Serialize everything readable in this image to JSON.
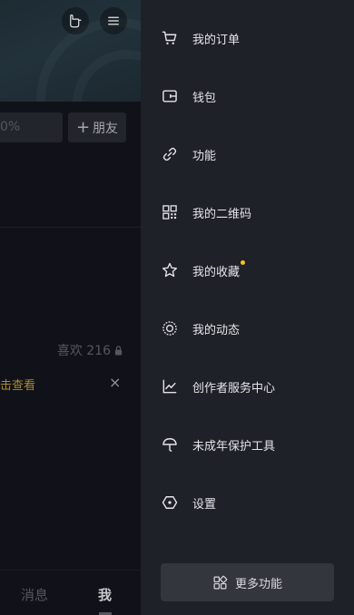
{
  "profile": {
    "edit_fragment": "0%",
    "add_friend_label": "朋友",
    "likes_text": "喜欢 216",
    "notice_fragment": "击查看",
    "notice_close": "×"
  },
  "tabbar": {
    "messages_label": "消息",
    "me_label": "我"
  },
  "drawer": {
    "items": [
      {
        "label": "我的订单",
        "icon": "cart-icon"
      },
      {
        "label": "钱包",
        "icon": "wallet-icon"
      },
      {
        "label": "功能",
        "icon": "link-icon"
      },
      {
        "label": "我的二维码",
        "icon": "qrcode-icon"
      },
      {
        "label": "我的收藏",
        "icon": "star-icon"
      },
      {
        "label": "我的动态",
        "icon": "activity-icon"
      },
      {
        "label": "创作者服务中心",
        "icon": "chart-icon"
      },
      {
        "label": "未成年保护工具",
        "icon": "umbrella-icon"
      },
      {
        "label": "设置",
        "icon": "settings-icon"
      }
    ],
    "more_label": "更多功能"
  },
  "colors": {
    "drawer_bg": "#1f2128",
    "accent_dot": "#f4c321",
    "notice_text": "#a8892c"
  }
}
